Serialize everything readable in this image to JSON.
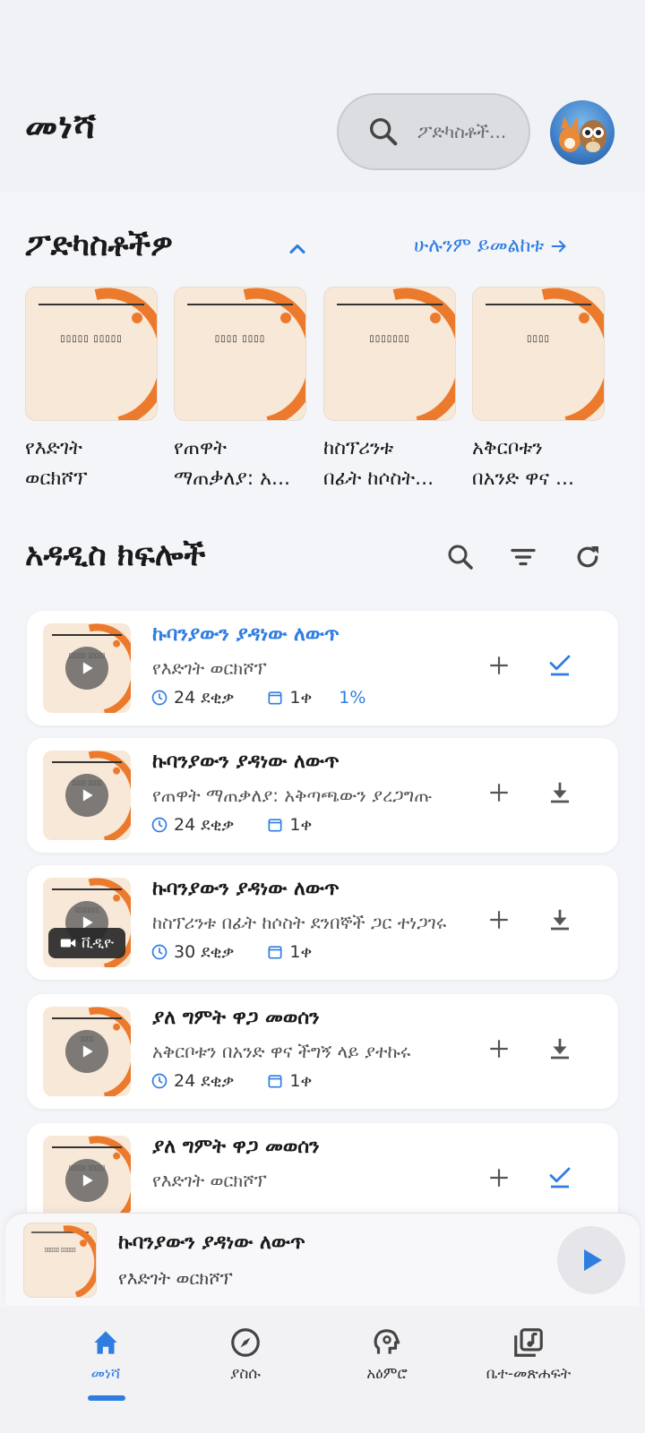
{
  "header": {
    "title": "መነሻ",
    "search_placeholder": "ፖድካስቶች..."
  },
  "podcasts": {
    "title": "ፖድካስቶችዎ",
    "see_all": "ሁሉንም ይመልከቱ",
    "items": [
      {
        "name": "የእድገት\nወርክሾፕ",
        "cover_title": "▯▯▯▯▯ ▯▯▯▯▯"
      },
      {
        "name": "የጠዋት\nማጠቃለያ: አ...",
        "cover_title": "▯▯▯▯ ▯▯▯▯"
      },
      {
        "name": "ከስፕሪንቱ\nበፊት ከሶስት...",
        "cover_title": "▯▯▯▯▯▯▯"
      },
      {
        "name": "አቅርቦቱን\nበአንድ ዋና ...",
        "cover_title": "▯▯▯▯"
      }
    ]
  },
  "episodes": {
    "title": "አዳዲስ ክፍሎች",
    "items": [
      {
        "title": "ኩባንያውን ያዳነው ለውጥ",
        "show": "የእድገት ወርክሾፕ",
        "duration": "24 ደቂቃ",
        "age": "1ቀ",
        "progress": "1%",
        "action": "check",
        "active": true,
        "cover_title": "▯▯▯▯▯ ▯▯▯▯▯"
      },
      {
        "title": "ኩባንያውን ያዳነው ለውጥ",
        "show": "የጠዋት ማጠቃለያ: አቅጣጫውን ያረጋግጡ",
        "duration": "24 ደቂቃ",
        "age": "1ቀ",
        "action": "download",
        "cover_title": "▯▯▯▯ ▯▯▯▯"
      },
      {
        "title": "ኩባንያውን ያዳነው ለውጥ",
        "show": "ከስፕሪንቱ በፊት ከሶስት ደንበኞች ጋር ተነጋገሩ",
        "duration": "30 ደቂቃ",
        "age": "1ቀ",
        "action": "download",
        "video_label": "ቪዲዮ",
        "cover_title": "▯▯▯▯▯▯▯"
      },
      {
        "title": "ያለ ግምት ዋጋ መወሰን",
        "show": "አቅርቦቱን በአንድ ዋና ችግኝ ላይ ያተኩሩ",
        "duration": "24 ደቂቃ",
        "age": "1ቀ",
        "action": "download",
        "cover_title": "▯▯▯▯"
      },
      {
        "title": "ያለ ግምት ዋጋ መወሰን",
        "show": "የእድገት ወርክሾፕ",
        "action": "check",
        "cover_title": "▯▯▯▯▯ ▯▯▯▯▯"
      }
    ]
  },
  "mini_player": {
    "title": "ኩባንያውን ያዳነው ለውጥ",
    "show": "የእድገት ወርክሾፕ",
    "cover_title": "▯▯▯▯▯ ▯▯▯▯▯"
  },
  "nav": {
    "items": [
      {
        "label": "መነሻ",
        "icon": "home-icon",
        "active": true
      },
      {
        "label": "ያስሱ",
        "icon": "compass-icon"
      },
      {
        "label": "አዕምሮ",
        "icon": "brain-head-icon"
      },
      {
        "label": "ቤተ-መጽሐፍት",
        "icon": "library-music-icon"
      }
    ]
  },
  "colors": {
    "accent": "#2f7de1",
    "cover_bg": "#f7e8d8",
    "cover_arc": "#ec7a2c"
  }
}
